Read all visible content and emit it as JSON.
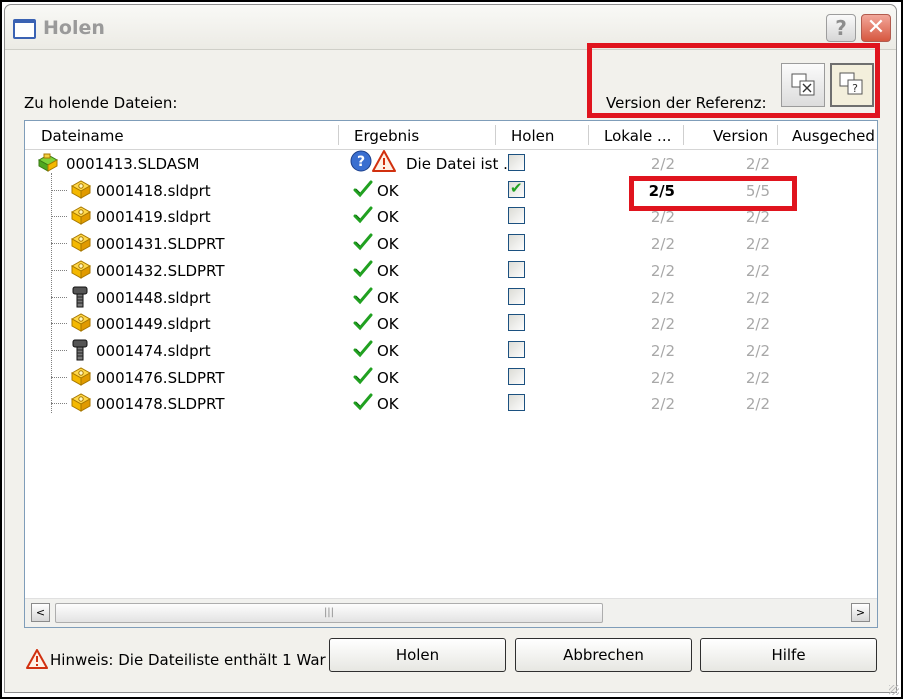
{
  "window": {
    "title": "Holen",
    "help_glyph": "?",
    "close_glyph": "✕"
  },
  "files_label": "Zu holende Dateien:",
  "reference": {
    "label": "Version der Referenz:",
    "buttons": [
      {
        "icon": "latest-version-icon"
      },
      {
        "icon": "referenced-version-icon",
        "active": true
      }
    ]
  },
  "columns": [
    "Dateiname",
    "Ergebnis",
    "Holen",
    "Lokale ...",
    "Version",
    "Ausgeched"
  ],
  "rows": [
    {
      "name": "0001413.SLDASM",
      "icon": "assembly-icon",
      "result": "Die Datei ist .",
      "result_icon": "question-warning-icon",
      "get": false,
      "local": "2/2",
      "version": "2/2",
      "root": true
    },
    {
      "name": "0001418.sldprt",
      "icon": "part-icon",
      "result": "OK",
      "get": true,
      "local": "2/5",
      "version": "5/5",
      "local_bold": true
    },
    {
      "name": "0001419.sldprt",
      "icon": "part-icon",
      "result": "OK",
      "get": false,
      "local": "2/2",
      "version": "2/2"
    },
    {
      "name": "0001431.SLDPRT",
      "icon": "part-icon",
      "result": "OK",
      "get": false,
      "local": "2/2",
      "version": "2/2"
    },
    {
      "name": "0001432.SLDPRT",
      "icon": "part-icon",
      "result": "OK",
      "get": false,
      "local": "2/2",
      "version": "2/2"
    },
    {
      "name": "0001448.sldprt",
      "icon": "bolt-icon",
      "result": "OK",
      "get": false,
      "local": "2/2",
      "version": "2/2"
    },
    {
      "name": "0001449.sldprt",
      "icon": "part-icon",
      "result": "OK",
      "get": false,
      "local": "2/2",
      "version": "2/2"
    },
    {
      "name": "0001474.sldprt",
      "icon": "bolt-icon",
      "result": "OK",
      "get": false,
      "local": "2/2",
      "version": "2/2"
    },
    {
      "name": "0001476.SLDPRT",
      "icon": "part-icon",
      "result": "OK",
      "get": false,
      "local": "2/2",
      "version": "2/2"
    },
    {
      "name": "0001478.SLDPRT",
      "icon": "part-icon",
      "result": "OK",
      "get": false,
      "local": "2/2",
      "version": "2/2"
    }
  ],
  "scrollbar": {
    "left_arrow": "<",
    "right_arrow": ">",
    "grip": "|||"
  },
  "footer": {
    "hint": "Hinweis: Die Dateiliste enthält 1 War",
    "buttons": {
      "get": "Holen",
      "cancel": "Abbrechen",
      "help": "Hilfe"
    }
  },
  "colors": {
    "highlight_red": "#e0141e",
    "ok_green": "#21a121",
    "part_yellow": "#f4b800"
  }
}
